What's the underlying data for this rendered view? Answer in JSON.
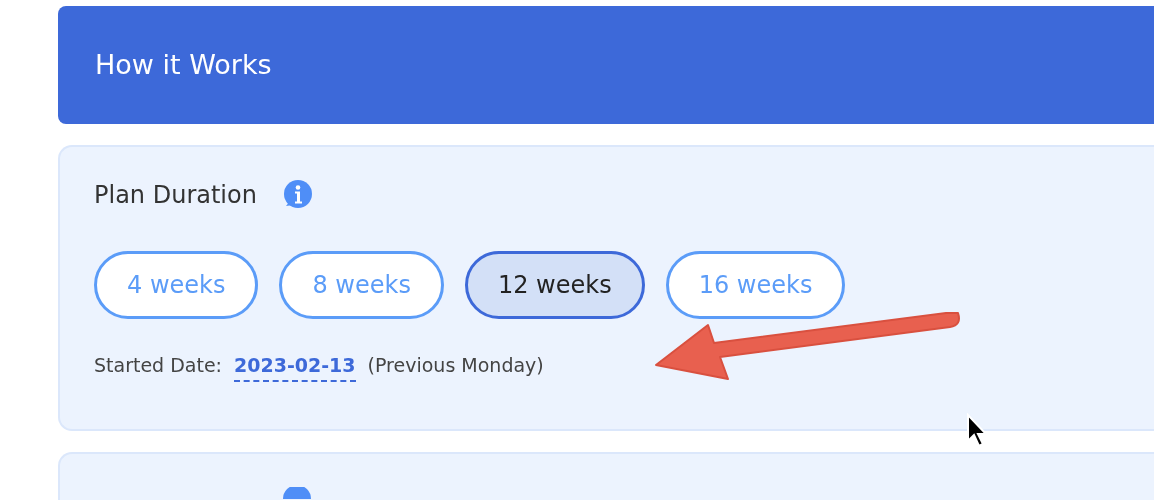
{
  "header": {
    "title": "How it Works"
  },
  "plan_duration": {
    "title": "Plan Duration",
    "options": [
      {
        "label": "4 weeks",
        "selected": false
      },
      {
        "label": "8 weeks",
        "selected": false
      },
      {
        "label": "12 weeks",
        "selected": true
      },
      {
        "label": "16 weeks",
        "selected": false
      }
    ],
    "started_label": "Started Date:",
    "started_date": "2023-02-13",
    "started_note": "(Previous Monday)"
  }
}
